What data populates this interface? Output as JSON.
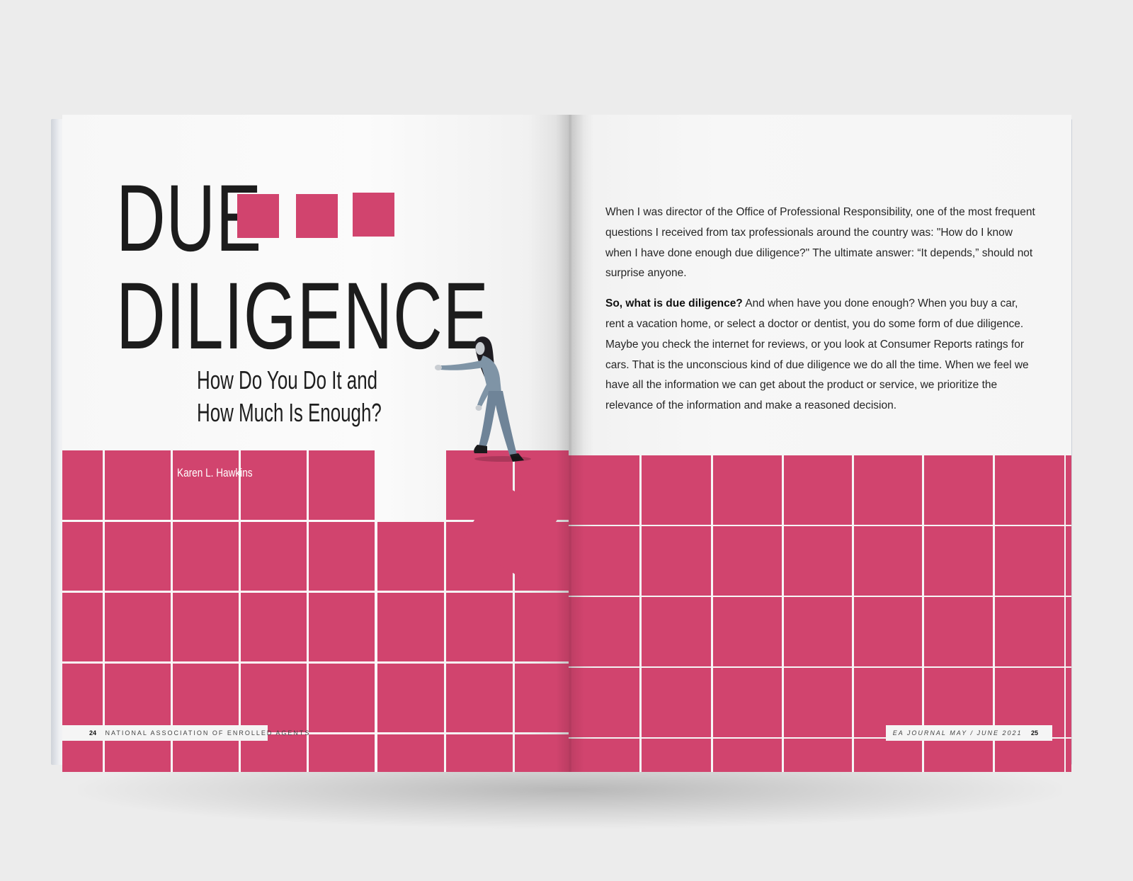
{
  "spread": {
    "left_page": {
      "title_line_1": "DUE",
      "title_line_2": "DILIGENCE",
      "subtitle_line_1": "How Do You Do It and",
      "subtitle_line_2": "How Much Is Enough?",
      "byline": "Karen L. Hawkins",
      "footer": {
        "page_number": "24",
        "publisher": "NATIONAL ASSOCIATION OF ENROLLED AGENTS"
      }
    },
    "right_page": {
      "paragraph_1": "When I was director of the Office of Professional Responsibility, one of the most frequent questions I received from tax professionals around the country was: \"How do I know when I have done enough due diligence?\" The ultimate answer: “It depends,” should not surprise anyone.",
      "paragraph_2_lead": "So, what is due diligence?",
      "paragraph_2_body": " And when have you done enough? When you buy a car, rent a vacation home, or select a doctor or dentist, you do some form of due diligence. Maybe you check the internet for reviews, or you look at Consumer Reports ratings for cars. That is the unconscious kind of due diligence we do all the time. When we feel we have all the information we can get about the product or service, we prioritize the relevance of the information and make a reasoned decision.",
      "footer": {
        "journal": "EA JOURNAL",
        "issue": "MAY / JUNE 2021",
        "page_number": "25"
      }
    }
  },
  "colors": {
    "accent": "#d1446e",
    "text": "#1c1c1c",
    "paper": "#f7f7f7",
    "background": "#ececec"
  }
}
